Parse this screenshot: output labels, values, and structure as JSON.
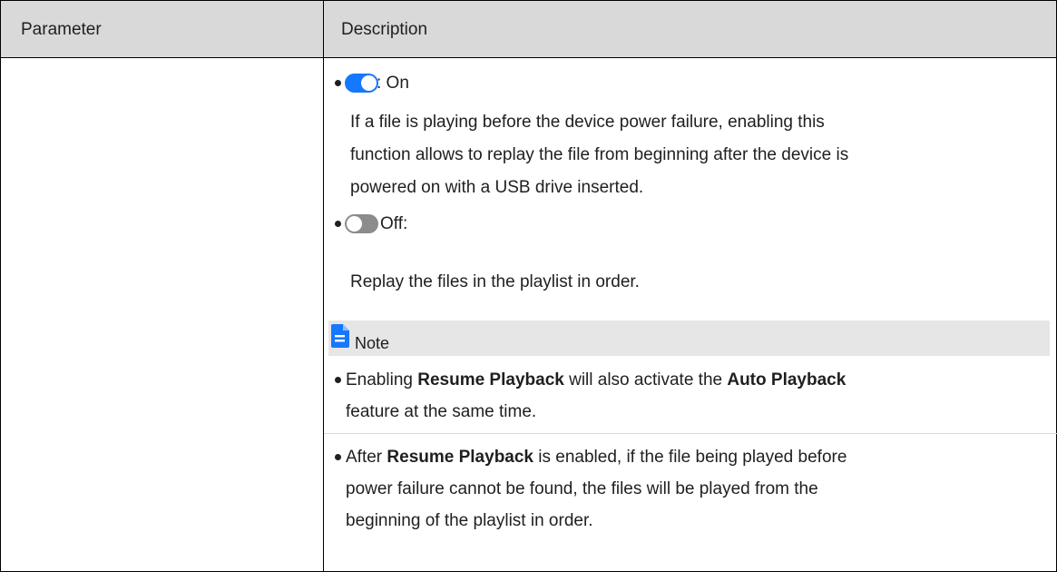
{
  "header": {
    "col_parameter": "Parameter",
    "col_description": "Description"
  },
  "on_option": {
    "label": ": On",
    "description_lines": [
      "If a file is playing before the device power failure, enabling this",
      "function allows to replay the file from beginning after the device is",
      "powered on with a USB drive inserted."
    ],
    "toggle_state": "on",
    "toggle_color": "#1677ff"
  },
  "off_option": {
    "label": "Off:",
    "description": "Replay the files in the playlist in order.",
    "toggle_state": "off",
    "toggle_color": "#8c8c8c"
  },
  "note": {
    "title": "Note",
    "icon": "note-document-icon",
    "icon_color": "#1677ff",
    "item1": {
      "pre": "Enabling ",
      "bold1": "Resume Playback",
      "mid": " will also activate the ",
      "bold2": "Auto Playback",
      "line2": "feature at the same time."
    },
    "item2": {
      "pre": "After ",
      "bold1": "Resume Playback",
      "post": " is enabled, if the file being played before",
      "line2": "power failure cannot be found, the files will be played from the",
      "line3": "beginning of the playlist in order."
    }
  }
}
